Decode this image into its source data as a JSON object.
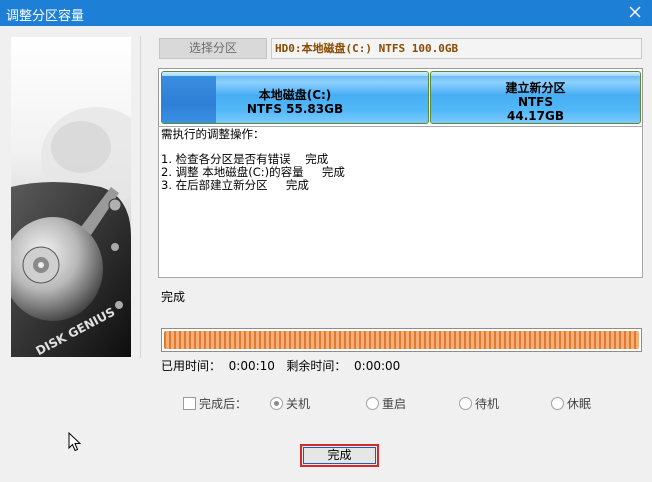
{
  "window": {
    "title": "调整分区容量"
  },
  "toolbar": {
    "select_partition_label": "选择分区",
    "disk_info": "HD0:本地磁盘(C:) NTFS 100.0GB"
  },
  "partitions": [
    {
      "name": "本地磁盘(C:)",
      "detail": "NTFS 55.83GB"
    },
    {
      "name": "建立新分区",
      "fs": "NTFS",
      "size": "44.17GB"
    }
  ],
  "operations": {
    "heading": "需执行的调整操作：",
    "steps": [
      "1. 检查各分区是否有错误    完成",
      "2. 调整 本地磁盘(C:)的容量     完成",
      "3. 在后部建立新分区     完成"
    ]
  },
  "status": {
    "text": "完成",
    "progress": 1.0
  },
  "times": {
    "elapsed_label": "已用时间：",
    "elapsed": "0:00:10",
    "remaining_label": "剩余时间：",
    "remaining": "0:00:00"
  },
  "after": {
    "label": "完成后：",
    "options": [
      "关机",
      "重启",
      "待机",
      "休眠"
    ],
    "selected": "关机"
  },
  "buttons": {
    "done_label": "完成"
  },
  "branding": {
    "image_text": "DISK GENIUS"
  },
  "colors": {
    "titlebar": "#1e7fd6",
    "progress": "#e07a30",
    "partition": "#52b8f8",
    "focus_border": "#d42a2a"
  }
}
